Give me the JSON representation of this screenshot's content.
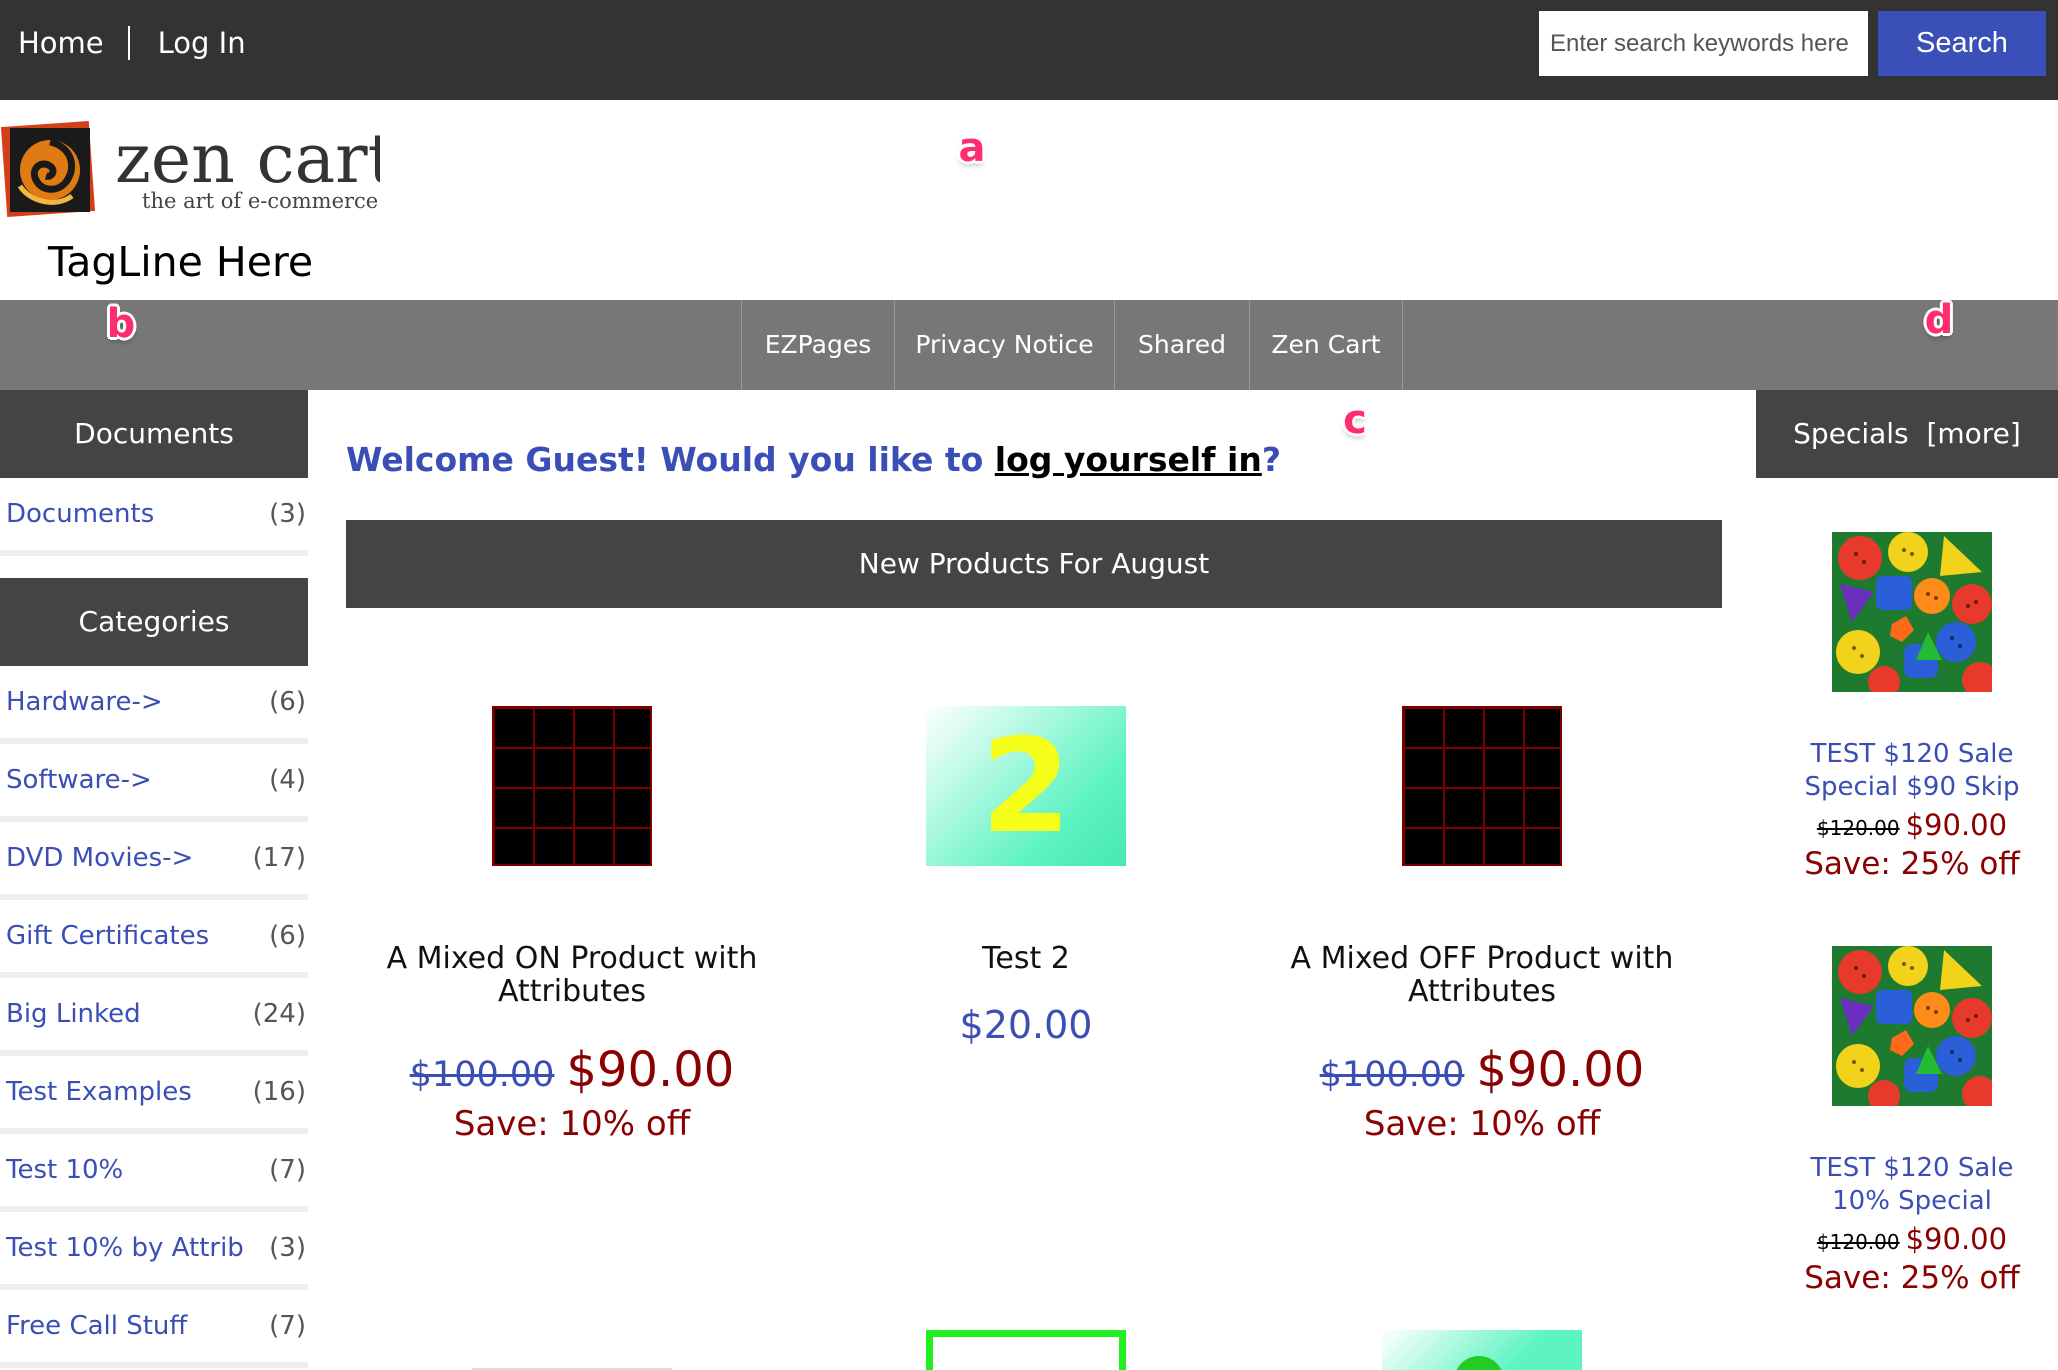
{
  "topnav": {
    "home": "Home",
    "login": "Log In"
  },
  "search": {
    "placeholder": "Enter search keywords here",
    "button": "Search"
  },
  "header": {
    "tagline": "TagLine Here",
    "logo_text": "zen cart",
    "logo_sub": "the art of e-commerce"
  },
  "markers": {
    "a": "a",
    "b": "b",
    "c": "c",
    "d": "d"
  },
  "navbar": {
    "items": [
      "EZPages",
      "Privacy Notice",
      "Shared",
      "Zen Cart"
    ]
  },
  "sidebar": {
    "documents_title": "Documents",
    "documents": [
      {
        "label": "Documents",
        "count": "(3)"
      }
    ],
    "categories_title": "Categories",
    "categories": [
      {
        "label": "Hardware->",
        "count": "(6)"
      },
      {
        "label": "Software->",
        "count": "(4)"
      },
      {
        "label": "DVD Movies->",
        "count": "(17)"
      },
      {
        "label": "Gift Certificates",
        "count": "(6)"
      },
      {
        "label": "Big Linked",
        "count": "(24)"
      },
      {
        "label": "Test Examples",
        "count": "(16)"
      },
      {
        "label": "Test 10%",
        "count": "(7)"
      },
      {
        "label": "Test 10% by Attrib",
        "count": "(3)"
      },
      {
        "label": "Free Call Stuff",
        "count": "(7)"
      }
    ]
  },
  "main": {
    "welcome_prefix": "Welcome Guest! Would you like to ",
    "welcome_link": "log yourself in",
    "welcome_suffix": "?",
    "new_products_title": "New Products For August",
    "products": [
      {
        "name_line1": "A Mixed ON Product with",
        "name_line2": "Attributes",
        "old_price": "$100.00",
        "new_price": "$90.00",
        "save": "Save: 10% off"
      },
      {
        "name_line1": "Test 2",
        "name_line2": "",
        "price": "$20.00",
        "image_digit": "2"
      },
      {
        "name_line1": "A Mixed OFF Product with",
        "name_line2": "Attributes",
        "old_price": "$100.00",
        "new_price": "$90.00",
        "save": "Save: 10% off"
      }
    ]
  },
  "specials": {
    "title": "Specials",
    "more": "[more]",
    "items": [
      {
        "name_line1": "TEST $120 Sale",
        "name_line2": "Special $90 Skip",
        "old_price": "$120.00",
        "new_price": "$90.00",
        "save": "Save: 25% off"
      },
      {
        "name_line1": "TEST $120 Sale",
        "name_line2": "10% Special",
        "old_price": "$120.00",
        "new_price": "$90.00",
        "save": "Save: 25% off"
      }
    ]
  },
  "colors": {
    "accent": "#3a4eb5",
    "sale": "#8b0000",
    "topbar": "#333333",
    "navbar": "#777777",
    "boxhead": "#444444"
  }
}
